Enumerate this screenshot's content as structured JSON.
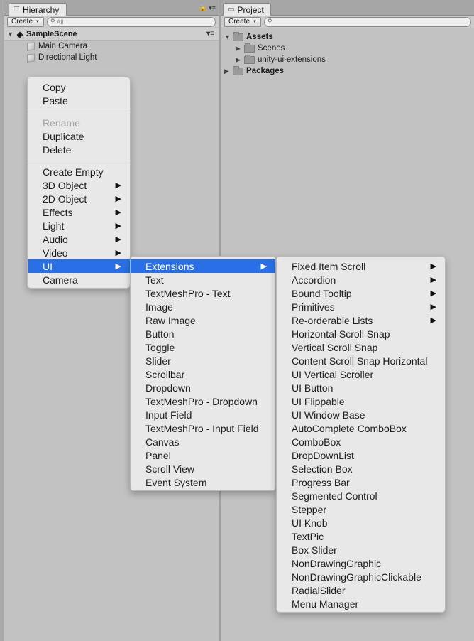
{
  "hierarchy": {
    "tab_label": "Hierarchy",
    "create_label": "Create",
    "search_placeholder": "All",
    "scene_name": "SampleScene",
    "objects": [
      "Main Camera",
      "Directional Light"
    ]
  },
  "project": {
    "tab_label": "Project",
    "create_label": "Create",
    "assets_label": "Assets",
    "asset_children": [
      "Scenes",
      "unity-ui-extensions"
    ],
    "packages_label": "Packages"
  },
  "context_menu": {
    "group1": [
      "Copy",
      "Paste"
    ],
    "group2": [
      {
        "label": "Rename",
        "disabled": true
      },
      {
        "label": "Duplicate"
      },
      {
        "label": "Delete"
      }
    ],
    "group3": [
      {
        "label": "Create Empty",
        "submenu": false
      },
      {
        "label": "3D Object",
        "submenu": true
      },
      {
        "label": "2D Object",
        "submenu": true
      },
      {
        "label": "Effects",
        "submenu": true
      },
      {
        "label": "Light",
        "submenu": true
      },
      {
        "label": "Audio",
        "submenu": true
      },
      {
        "label": "Video",
        "submenu": true
      },
      {
        "label": "UI",
        "submenu": true,
        "highlighted": true
      },
      {
        "label": "Camera",
        "submenu": false
      }
    ]
  },
  "ui_submenu": {
    "items": [
      {
        "label": "Extensions",
        "submenu": true,
        "highlighted": true
      },
      {
        "label": "Text"
      },
      {
        "label": "TextMeshPro - Text"
      },
      {
        "label": "Image"
      },
      {
        "label": "Raw Image"
      },
      {
        "label": "Button"
      },
      {
        "label": "Toggle"
      },
      {
        "label": "Slider"
      },
      {
        "label": "Scrollbar"
      },
      {
        "label": "Dropdown"
      },
      {
        "label": "TextMeshPro - Dropdown"
      },
      {
        "label": "Input Field"
      },
      {
        "label": "TextMeshPro - Input Field"
      },
      {
        "label": "Canvas"
      },
      {
        "label": "Panel"
      },
      {
        "label": "Scroll View"
      },
      {
        "label": "Event System"
      }
    ]
  },
  "extensions_submenu": {
    "items": [
      {
        "label": "Fixed Item Scroll",
        "submenu": true
      },
      {
        "label": "Accordion",
        "submenu": true
      },
      {
        "label": "Bound Tooltip",
        "submenu": true
      },
      {
        "label": "Primitives",
        "submenu": true
      },
      {
        "label": "Re-orderable Lists",
        "submenu": true
      },
      {
        "label": "Horizontal Scroll Snap"
      },
      {
        "label": "Vertical Scroll Snap"
      },
      {
        "label": "Content Scroll Snap Horizontal"
      },
      {
        "label": "UI Vertical Scroller"
      },
      {
        "label": "UI Button"
      },
      {
        "label": "UI Flippable"
      },
      {
        "label": "UI Window Base"
      },
      {
        "label": "AutoComplete ComboBox"
      },
      {
        "label": "ComboBox"
      },
      {
        "label": "DropDownList"
      },
      {
        "label": "Selection Box"
      },
      {
        "label": "Progress Bar"
      },
      {
        "label": "Segmented Control"
      },
      {
        "label": "Stepper"
      },
      {
        "label": "UI Knob"
      },
      {
        "label": "TextPic"
      },
      {
        "label": "Box Slider"
      },
      {
        "label": "NonDrawingGraphic"
      },
      {
        "label": "NonDrawingGraphicClickable"
      },
      {
        "label": "RadialSlider"
      },
      {
        "label": "Menu Manager"
      }
    ]
  },
  "colors": {
    "highlight": "#2b6fe7",
    "menu_bg": "#e8e8e8",
    "panel_bg": "#c2c2c2"
  }
}
